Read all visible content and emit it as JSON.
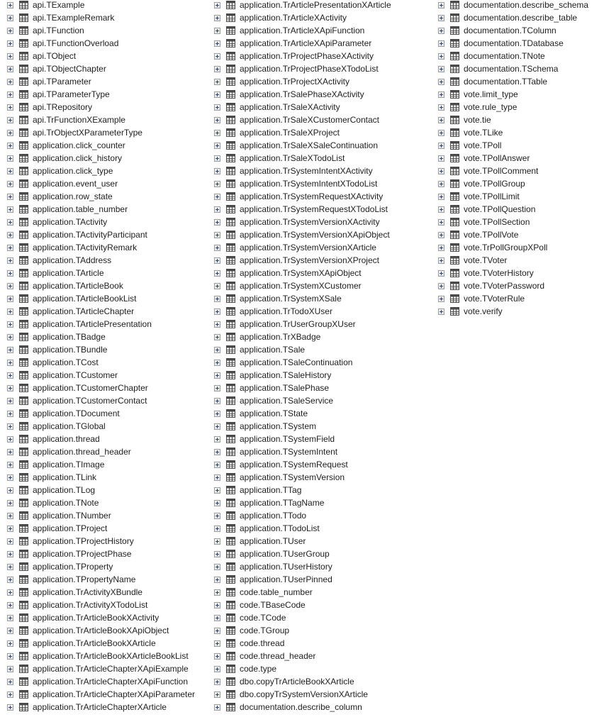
{
  "columns": [
    [
      "api.TExample",
      "api.TExampleRemark",
      "api.TFunction",
      "api.TFunctionOverload",
      "api.TObject",
      "api.TObjectChapter",
      "api.TParameter",
      "api.TParameterType",
      "api.TRepository",
      "api.TrFunctionXExample",
      "api.TrObjectXParameterType",
      "application.click_counter",
      "application.click_history",
      "application.click_type",
      "application.event_user",
      "application.row_state",
      "application.table_number",
      "application.TActivity",
      "application.TActivityParticipant",
      "application.TActivityRemark",
      "application.TAddress",
      "application.TArticle",
      "application.TArticleBook",
      "application.TArticleBookList",
      "application.TArticleChapter",
      "application.TArticlePresentation",
      "application.TBadge",
      "application.TBundle",
      "application.TCost",
      "application.TCustomer",
      "application.TCustomerChapter",
      "application.TCustomerContact",
      "application.TDocument",
      "application.TGlobal",
      "application.thread",
      "application.thread_header",
      "application.TImage",
      "application.TLink",
      "application.TLog",
      "application.TNote",
      "application.TNumber",
      "application.TProject",
      "application.TProjectHistory",
      "application.TProjectPhase",
      "application.TProperty",
      "application.TPropertyName",
      "application.TrActivityXBundle",
      "application.TrActivityXTodoList",
      "application.TrArticleBookXActivity",
      "application.TrArticleBookXApiObject",
      "application.TrArticleBookXArticle",
      "application.TrArticleBookXArticleBookList",
      "application.TrArticleChapterXApiExample",
      "application.TrArticleChapterXApiFunction",
      "application.TrArticleChapterXApiParameter",
      "application.TrArticleChapterXArticle"
    ],
    [
      "application.TrArticlePresentationXArticle",
      "application.TrArticleXActivity",
      "application.TrArticleXApiFunction",
      "application.TrArticleXApiParameter",
      "application.TrProjectPhaseXActivity",
      "application.TrProjectPhaseXTodoList",
      "application.TrProjectXActivity",
      "application.TrSalePhaseXActivity",
      "application.TrSaleXActivity",
      "application.TrSaleXCustomerContact",
      "application.TrSaleXProject",
      "application.TrSaleXSaleContinuation",
      "application.TrSaleXTodoList",
      "application.TrSystemIntentXActivity",
      "application.TrSystemIntentXTodoList",
      "application.TrSystemRequestXActivity",
      "application.TrSystemRequestXTodoList",
      "application.TrSystemVersionXActivity",
      "application.TrSystemVersionXApiObject",
      "application.TrSystemVersionXArticle",
      "application.TrSystemVersionXProject",
      "application.TrSystemXApiObject",
      "application.TrSystemXCustomer",
      "application.TrSystemXSale",
      "application.TrTodoXUser",
      "application.TrUserGroupXUser",
      "application.TrXBadge",
      "application.TSale",
      "application.TSaleContinuation",
      "application.TSaleHistory",
      "application.TSalePhase",
      "application.TSaleService",
      "application.TState",
      "application.TSystem",
      "application.TSystemField",
      "application.TSystemIntent",
      "application.TSystemRequest",
      "application.TSystemVersion",
      "application.TTag",
      "application.TTagName",
      "application.TTodo",
      "application.TTodoList",
      "application.TUser",
      "application.TUserGroup",
      "application.TUserHistory",
      "application.TUserPinned",
      "code.table_number",
      "code.TBaseCode",
      "code.TCode",
      "code.TGroup",
      "code.thread",
      "code.thread_header",
      "code.type",
      "dbo.copyTrArticleBookXArticle",
      "dbo.copyTrSystemVersionXArticle",
      "documentation.describe_column"
    ],
    [
      "documentation.describe_schema",
      "documentation.describe_table",
      "documentation.TColumn",
      "documentation.TDatabase",
      "documentation.TNote",
      "documentation.TSchema",
      "documentation.TTable",
      "vote.limit_type",
      "vote.rule_type",
      "vote.tie",
      "vote.TLike",
      "vote.TPoll",
      "vote.TPollAnswer",
      "vote.TPollComment",
      "vote.TPollGroup",
      "vote.TPollLimit",
      "vote.TPollQuestion",
      "vote.TPollSection",
      "vote.TPollVote",
      "vote.TrPollGroupXPoll",
      "vote.TVoter",
      "vote.TVoterHistory",
      "vote.TVoterPassword",
      "vote.TVoterRule",
      "vote.verify"
    ]
  ],
  "icons": {
    "expander": "plus-box-icon",
    "table": "table-grid-icon"
  }
}
